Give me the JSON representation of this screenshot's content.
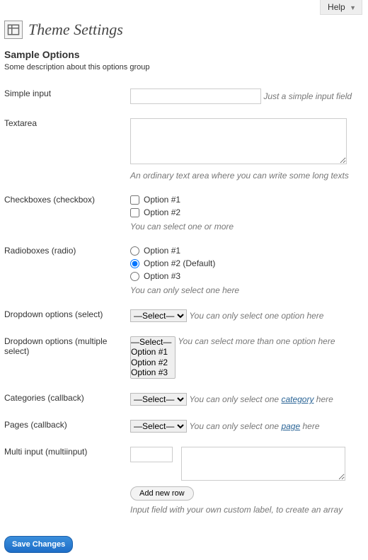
{
  "help": {
    "label": "Help"
  },
  "header": {
    "title": "Theme Settings"
  },
  "section": {
    "title": "Sample Options",
    "description": "Some description about this options group"
  },
  "fields": {
    "simple": {
      "label": "Simple input",
      "hint": "Just a simple input field"
    },
    "textarea": {
      "label": "Textarea",
      "hint": "An ordinary text area where you can write some long texts"
    },
    "checkboxes": {
      "label": "Checkboxes (checkbox)",
      "opt1": "Option #1",
      "opt2": "Option #2",
      "hint": "You can select one or more"
    },
    "radios": {
      "label": "Radioboxes (radio)",
      "opt1": "Option #1",
      "opt2": "Option #2 (Default)",
      "opt3": "Option #3",
      "hint": "You can only select one here"
    },
    "dropdown": {
      "label": "Dropdown options (select)",
      "selected": "—Select—",
      "hint": "You can only select one option here"
    },
    "multiselect": {
      "label": "Dropdown options (multiple select)",
      "opt0": "—Select—",
      "opt1": "Option #1",
      "opt2": "Option #2",
      "opt3": "Option #3",
      "hint": "You can select more than one option here"
    },
    "categories": {
      "label": "Categories (callback)",
      "selected": "—Select—",
      "hint_pre": "You can only select one ",
      "hint_link": "category",
      "hint_post": " here"
    },
    "pages": {
      "label": "Pages (callback)",
      "selected": "—Select—",
      "hint_pre": "You can only select one ",
      "hint_link": "page",
      "hint_post": " here"
    },
    "multiinput": {
      "label": "Multi input (multiinput)",
      "add_label": "Add new row",
      "hint": "Input field with your own custom label, to create an array"
    }
  },
  "actions": {
    "save": "Save Changes"
  }
}
